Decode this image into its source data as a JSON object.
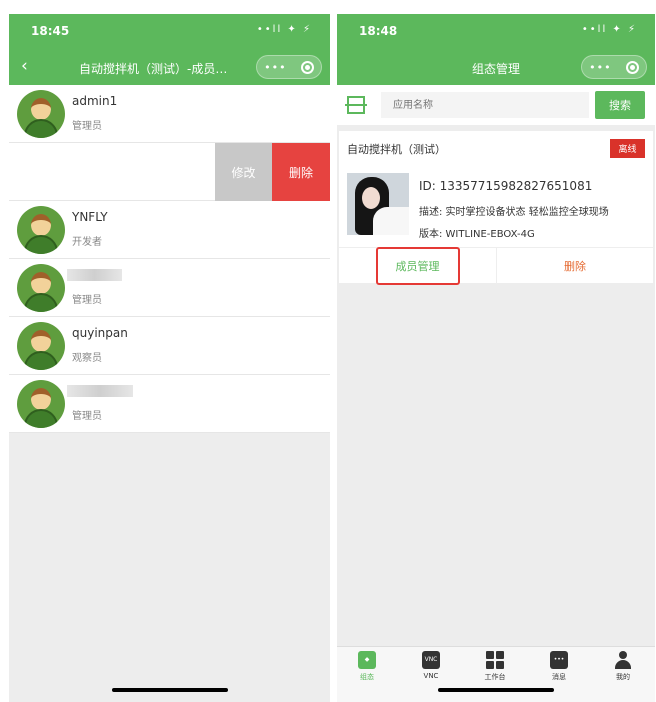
{
  "left": {
    "status_time": "18:45",
    "status_icons": "••ll ✦ ⚡",
    "nav_back": "‹",
    "title": "自动搅拌机（测试）-成员…",
    "capsule_dots": "•••",
    "members": [
      {
        "name": "admin1",
        "role": "管理员"
      },
      {
        "name": "YNFLY",
        "role": "开发者"
      },
      {
        "name": "",
        "role": "管理员"
      },
      {
        "name": "quyinpan",
        "role": "观察员"
      },
      {
        "name": "",
        "role": "管理员"
      }
    ],
    "swipe_actions": {
      "edit": "修改",
      "delete": "删除"
    }
  },
  "right": {
    "status_time": "18:48",
    "status_icons": "••ll ✦ ⚡",
    "title": "组态管理",
    "capsule_dots": "•••",
    "search": {
      "placeholder": "应用名称",
      "button": "搜索"
    },
    "card": {
      "title": "自动搅拌机（测试）",
      "status_badge": "离线",
      "id_line": "ID: 13357715982827651081",
      "description": "描述: 实时掌控设备状态 轻松监控全球现场",
      "version": "版本: WITLINE-EBOX-4G",
      "actions": {
        "members": "成员管理",
        "delete": "删除"
      }
    },
    "tabbar": [
      {
        "label": "组态",
        "icon": "layers-icon",
        "active": true
      },
      {
        "label": "VNC",
        "icon": "vnc-icon",
        "active": false
      },
      {
        "label": "工作台",
        "icon": "grid-icon",
        "active": false
      },
      {
        "label": "消息",
        "icon": "chat-icon",
        "active": false
      },
      {
        "label": "我的",
        "icon": "person-icon",
        "active": false
      }
    ],
    "tab_icon_text": {
      "layers": "◆",
      "vnc": "VNC",
      "chat": "•••"
    }
  },
  "colors": {
    "brand_green": "#5cb85c",
    "danger_red": "#e64340",
    "offline_red": "#d9322a",
    "delete_orange": "#e56a31"
  }
}
